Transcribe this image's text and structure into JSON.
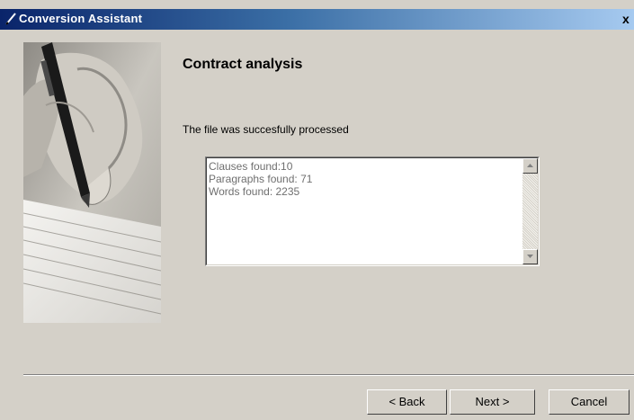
{
  "window": {
    "title": "Conversion Assistant",
    "close_glyph": "x"
  },
  "page": {
    "heading": "Contract analysis",
    "status": "The file was succesfully processed"
  },
  "results": {
    "lines": [
      "Clauses found:10",
      "Paragraphs found: 71",
      "Words found: 2235"
    ]
  },
  "buttons": {
    "back": "< Back",
    "next": "Next >",
    "cancel": "Cancel"
  },
  "icons": {
    "app": "pen-icon",
    "side_image": "hand-writing-photo",
    "scroll_up": "scroll-up-arrow-icon",
    "scroll_down": "scroll-down-arrow-icon"
  }
}
